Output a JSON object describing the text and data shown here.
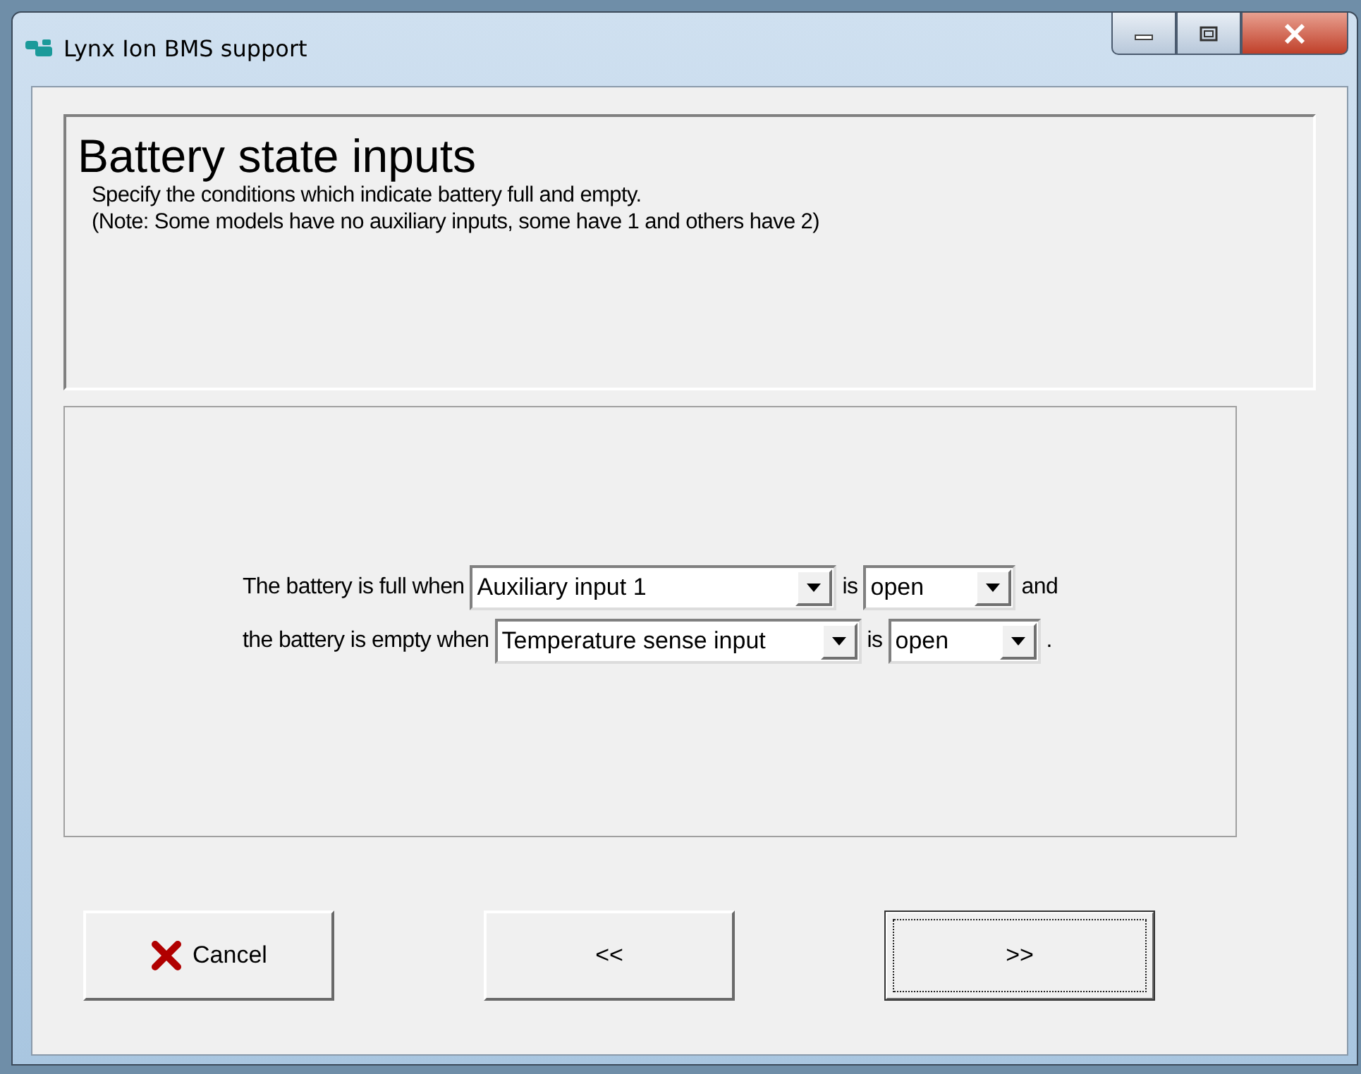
{
  "window": {
    "title": "Lynx Ion BMS support"
  },
  "header": {
    "title": "Battery state inputs",
    "lines": [
      "Specify the conditions which indicate battery full and empty.",
      "(Note: Some models have no auxiliary inputs, some have 1 and others have 2)"
    ]
  },
  "rows": [
    {
      "parts": [
        {
          "kind": "text",
          "text": "The battery is full when"
        },
        {
          "kind": "select",
          "value": "Auxiliary input 1"
        },
        {
          "kind": "text",
          "text": "is"
        },
        {
          "kind": "select",
          "value": "open"
        },
        {
          "kind": "text",
          "text": "and"
        }
      ]
    },
    {
      "parts": [
        {
          "kind": "text",
          "text": "the battery is empty when"
        },
        {
          "kind": "select",
          "value": "Temperature sense input"
        },
        {
          "kind": "text",
          "text": "is"
        },
        {
          "kind": "select",
          "value": "open"
        },
        {
          "kind": "text",
          "text": "."
        }
      ]
    }
  ],
  "buttons": [
    {
      "label": "Cancel",
      "kind": "cancel",
      "focused": false
    },
    {
      "label": "<<",
      "kind": "nav",
      "focused": false
    },
    {
      "label": ">>",
      "kind": "nav",
      "focused": true
    }
  ]
}
